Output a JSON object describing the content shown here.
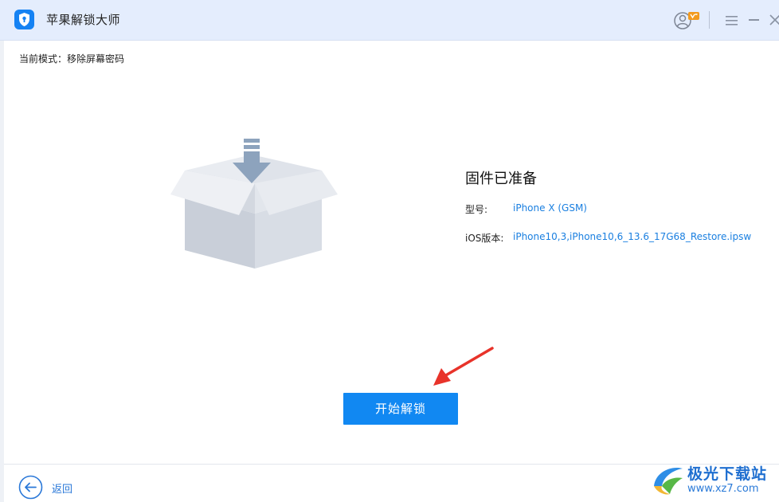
{
  "window": {
    "title": "苹果解锁大师"
  },
  "mode": {
    "label": "当前模式：移除屏幕密码"
  },
  "firmware": {
    "title": "固件已准备",
    "model_label": "型号:",
    "model_value": "iPhone X (GSM)",
    "ios_label": "iOS版本:",
    "ios_value": "iPhone10,3,iPhone10,6_13.6_17G68_Restore.ipsw"
  },
  "actions": {
    "start_label": "开始解锁",
    "back_label": "返回"
  },
  "watermark": {
    "name": "极光下载站",
    "url": "www.xz7.com"
  },
  "icons": [
    "app-logo-icon",
    "user-icon",
    "menu-icon",
    "minimize-icon",
    "close-icon",
    "box-download-icon",
    "red-arrow-icon",
    "back-arrow-icon"
  ],
  "colors": {
    "titlebar_bg": "#e4edfd",
    "accent": "#1188f2",
    "link": "#1a7fe0",
    "arrow": "#e8332a"
  }
}
